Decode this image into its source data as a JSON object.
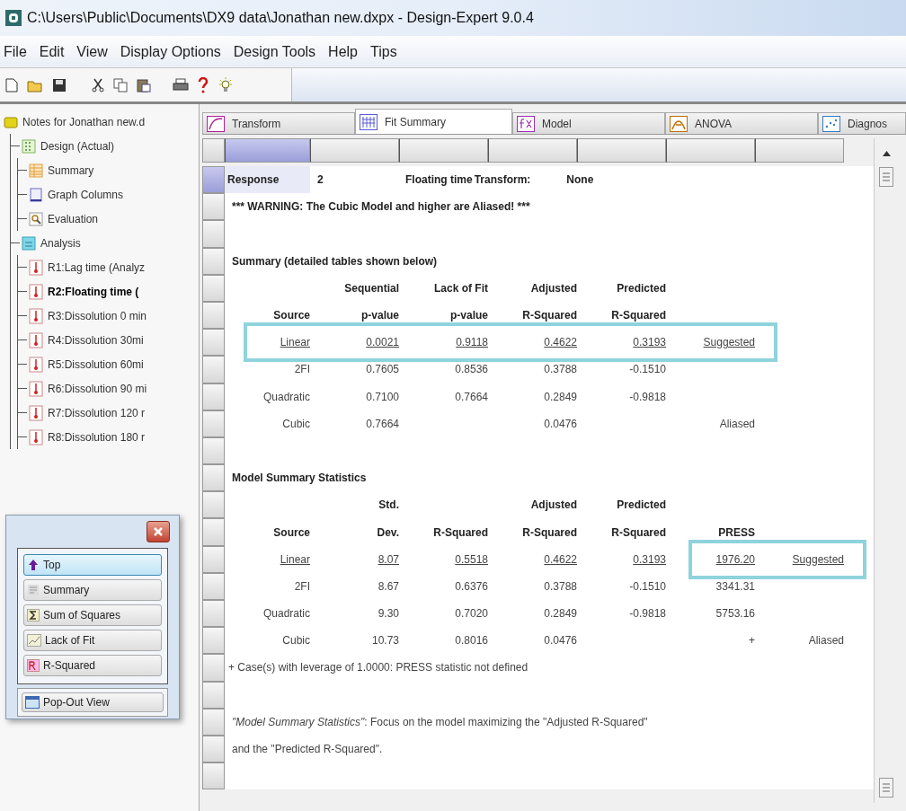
{
  "window": {
    "title": "C:\\Users\\Public\\Documents\\DX9 data\\Jonathan new.dxpx - Design-Expert 9.0.4"
  },
  "menu": [
    "File",
    "Edit",
    "View",
    "Display Options",
    "Design Tools",
    "Help",
    "Tips"
  ],
  "tree": {
    "label": "Notes for Jonathan new.d",
    "kind": "notes",
    "selected": false,
    "children": [
      {
        "label": "Design (Actual)",
        "kind": "design",
        "selected": false,
        "children": [
          {
            "label": "Summary",
            "kind": "summary",
            "selected": false
          },
          {
            "label": "Graph Columns",
            "kind": "graph",
            "selected": false
          },
          {
            "label": "Evaluation",
            "kind": "evaluation",
            "selected": false
          }
        ]
      },
      {
        "label": "Analysis",
        "kind": "analysis",
        "selected": false,
        "children": [
          {
            "label": "R1:Lag time (Analyz",
            "kind": "response",
            "selected": false
          },
          {
            "label": "R2:Floating time (",
            "kind": "response",
            "selected": true
          },
          {
            "label": "R3:Dissolution 0 min",
            "kind": "response",
            "selected": false
          },
          {
            "label": "R4:Dissolution 30mi",
            "kind": "response",
            "selected": false
          },
          {
            "label": "R5:Dissolution 60mi",
            "kind": "response",
            "selected": false
          },
          {
            "label": "R6:Dissolution 90 mi",
            "kind": "response",
            "selected": false
          },
          {
            "label": "R7:Dissolution 120 r",
            "kind": "response",
            "selected": false
          },
          {
            "label": "R8:Dissolution 180 r",
            "kind": "response",
            "selected": false
          }
        ]
      }
    ]
  },
  "nav_panel": {
    "buttons": [
      {
        "label": "Top",
        "kind": "top",
        "selected": true
      },
      {
        "label": "Summary",
        "kind": "summary",
        "selected": false
      },
      {
        "label": "Sum of Squares",
        "kind": "sum",
        "selected": false
      },
      {
        "label": "Lack of Fit",
        "kind": "lof",
        "selected": false
      },
      {
        "label": "R-Squared",
        "kind": "rsq",
        "selected": false
      }
    ],
    "popout": {
      "label": "Pop-Out View"
    }
  },
  "tabs": [
    {
      "label": "Transform",
      "kind": "transform",
      "selected": false
    },
    {
      "label": "Fit Summary",
      "kind": "fit",
      "selected": true
    },
    {
      "label": "Model",
      "kind": "model",
      "selected": false
    },
    {
      "label": "ANOVA",
      "kind": "anova",
      "selected": false
    },
    {
      "label": "Diagnos",
      "kind": "diagnostics",
      "selected": false
    }
  ],
  "report": [
    {
      "kind": "response",
      "selected": true,
      "label": "Response",
      "number": "2",
      "name": "Floating time",
      "transform_label": "Transform:",
      "transform": "None"
    },
    {
      "kind": "warning",
      "text": "*** WARNING:  The Cubic Model and higher are Aliased! ***"
    },
    {
      "kind": "blank"
    },
    {
      "kind": "title",
      "text": "Summary (detailed tables shown below)"
    },
    {
      "kind": "header",
      "cells": [
        null,
        "Sequential",
        "Lack of Fit",
        "Adjusted",
        "Predicted"
      ]
    },
    {
      "kind": "header",
      "cells": [
        "Source",
        "p-value",
        "p-value",
        "R-Squared",
        "R-Squared"
      ]
    },
    {
      "kind": "data",
      "underlined": true,
      "boxed": true,
      "box_whole_row": true,
      "cells": [
        "Linear",
        "0.0021",
        "0.9118",
        "0.4622",
        "0.3193",
        "Suggested"
      ]
    },
    {
      "kind": "data",
      "cells": [
        "2FI",
        "0.7605",
        "0.8536",
        "0.3788",
        "-0.1510"
      ]
    },
    {
      "kind": "data",
      "cells": [
        "Quadratic",
        "0.7100",
        "0.7664",
        "0.2849",
        "-0.9818"
      ]
    },
    {
      "kind": "data",
      "cells": [
        "Cubic",
        "0.7664",
        null,
        "0.0476",
        null,
        "Aliased"
      ]
    },
    {
      "kind": "blank"
    },
    {
      "kind": "title",
      "text": "Model Summary Statistics"
    },
    {
      "kind": "header",
      "cells": [
        null,
        "Std.",
        null,
        "Adjusted",
        "Predicted"
      ]
    },
    {
      "kind": "header",
      "cells": [
        "Source",
        "Dev.",
        "R-Squared",
        "R-Squared",
        "R-Squared",
        "PRESS"
      ]
    },
    {
      "kind": "data",
      "underlined": true,
      "boxed": true,
      "box_whole_row": false,
      "cells": [
        "Linear",
        "8.07",
        "0.5518",
        "0.4622",
        "0.3193",
        "1976.20",
        "Suggested"
      ]
    },
    {
      "kind": "data",
      "cells": [
        "2FI",
        "8.67",
        "0.6376",
        "0.3788",
        "-0.1510",
        "3341.31"
      ]
    },
    {
      "kind": "data",
      "cells": [
        "Quadratic",
        "9.30",
        "0.7020",
        "0.2849",
        "-0.9818",
        "5753.16"
      ]
    },
    {
      "kind": "data",
      "cells": [
        "Cubic",
        "10.73",
        "0.8016",
        "0.0476",
        null,
        "+",
        "Aliased"
      ]
    },
    {
      "kind": "footnote",
      "text": "+ Case(s) with leverage of 1.0000:  PRESS statistic not defined"
    },
    {
      "kind": "blank"
    },
    {
      "kind": "note",
      "text": "*\"Model Summary Statistics\"*:  Focus on the model maximizing the \"Adjusted R-Squared\""
    },
    {
      "kind": "note",
      "text": "and the \"Predicted R-Squared\"."
    },
    {
      "kind": "blank"
    }
  ]
}
